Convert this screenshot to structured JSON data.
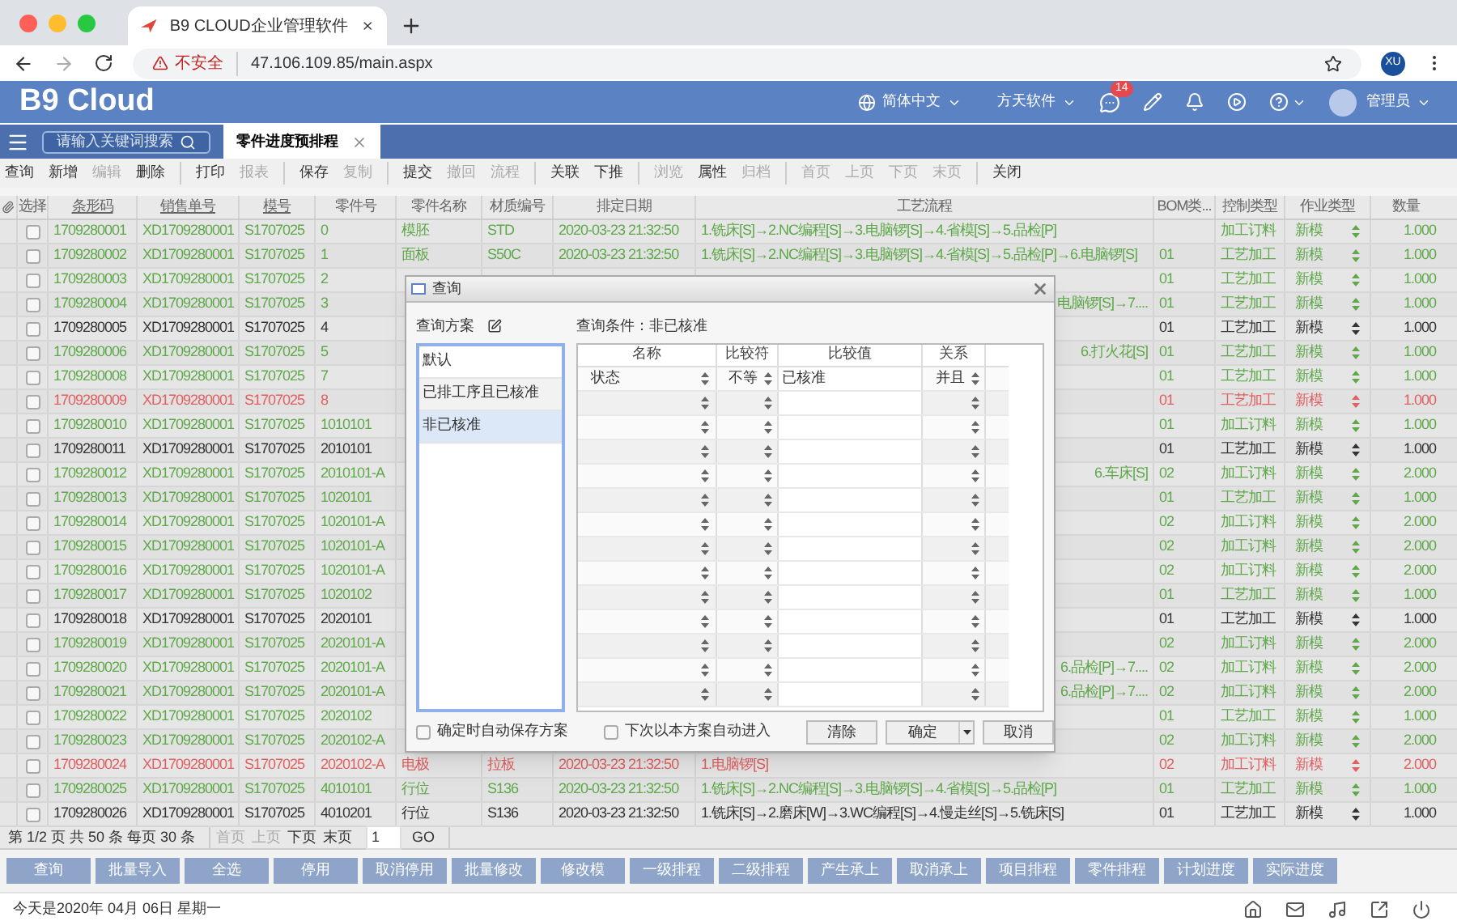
{
  "browser": {
    "tab_title": "B9 CLOUD企业管理软件",
    "url_warning": "不安全",
    "url": "47.106.109.85/main.aspx",
    "profile": "XU"
  },
  "header": {
    "logo": "B9 Cloud",
    "language": "简体中文",
    "company": "方天软件",
    "notification_count": "14",
    "user": "管理员"
  },
  "search": {
    "placeholder": "请输入关键词搜索"
  },
  "tabs": [
    {
      "label": "零件进度预排程",
      "selected": true
    }
  ],
  "toolbar": [
    [
      {
        "label": "查询",
        "disabled": false
      },
      {
        "label": "新增",
        "disabled": false
      },
      {
        "label": "编辑",
        "disabled": true
      },
      {
        "label": "删除",
        "disabled": false
      }
    ],
    [
      {
        "label": "打印",
        "disabled": false
      },
      {
        "label": "报表",
        "disabled": true
      }
    ],
    [
      {
        "label": "保存",
        "disabled": false
      },
      {
        "label": "复制",
        "disabled": true
      }
    ],
    [
      {
        "label": "提交",
        "disabled": false
      },
      {
        "label": "撤回",
        "disabled": true
      },
      {
        "label": "流程",
        "disabled": true
      }
    ],
    [
      {
        "label": "关联",
        "disabled": false
      },
      {
        "label": "下推",
        "disabled": false
      }
    ],
    [
      {
        "label": "浏览",
        "disabled": true
      },
      {
        "label": "属性",
        "disabled": false
      },
      {
        "label": "归档",
        "disabled": true
      }
    ],
    [
      {
        "label": "首页",
        "disabled": true
      },
      {
        "label": "上页",
        "disabled": true
      },
      {
        "label": "下页",
        "disabled": true
      },
      {
        "label": "末页",
        "disabled": true
      }
    ],
    [
      {
        "label": "关闭",
        "disabled": false
      }
    ]
  ],
  "table": {
    "columns": [
      {
        "label": "选择",
        "underlined": false
      },
      {
        "label": "条形码",
        "underlined": true
      },
      {
        "label": "销售单号",
        "underlined": true
      },
      {
        "label": "模号",
        "underlined": true
      },
      {
        "label": "零件号",
        "underlined": false
      },
      {
        "label": "零件名称",
        "underlined": false
      },
      {
        "label": "材质编号",
        "underlined": false
      },
      {
        "label": "排定日期",
        "underlined": false
      },
      {
        "label": "工艺流程",
        "underlined": false
      },
      {
        "label": "BOM类...",
        "underlined": false
      },
      {
        "label": "控制类型",
        "underlined": false
      },
      {
        "label": "作业类型",
        "underlined": false
      },
      {
        "label": "数量",
        "underlined": false
      }
    ],
    "rows": [
      {
        "checked": false,
        "color": "#5fa84a",
        "barcode": "1709280001",
        "order": "XD1709280001",
        "mold": "S1707025",
        "part_no": "0",
        "part_name": "模胚",
        "material": "STD",
        "date": "2020-03-23 21:32:50",
        "process": "1.铣床[S]→2.NC编程[S]→3.电脑锣[S]→4.省模[S]→5.品检[P]",
        "control": "加工订料",
        "job": "新模",
        "qty": "1.000"
      },
      {
        "checked": false,
        "color": "#5fa84a",
        "barcode": "1709280002",
        "order": "XD1709280001",
        "mold": "S1707025",
        "part_no": "1",
        "part_name": "面板",
        "material": "S50C",
        "date": "2020-03-23 21:32:50",
        "process": "1.铣床[S]→2.NC编程[S]→3.电脑锣[S]→4.省模[S]→5.品检[P]→6.电脑锣[S]",
        "bom": "01",
        "control": "工艺加工",
        "job": "新模",
        "qty": "1.000"
      },
      {
        "checked": false,
        "color": "#5fa84a",
        "barcode": "1709280003",
        "order": "XD1709280001",
        "mold": "S1707025",
        "part_no": "2",
        "bom": "01",
        "control": "工艺加工",
        "job": "新模",
        "qty": "1.000"
      },
      {
        "checked": false,
        "color": "#5fa84a",
        "barcode": "1709280004",
        "order": "XD1709280001",
        "mold": "S1707025",
        "part_no": "3",
        "process_tail": "电脑锣[S]→7....",
        "bom": "01",
        "control": "工艺加工",
        "job": "新模",
        "qty": "1.000"
      },
      {
        "checked": false,
        "color": "#333333",
        "barcode": "1709280005",
        "order": "XD1709280001",
        "mold": "S1707025",
        "part_no": "4",
        "bom": "01",
        "control": "工艺加工",
        "job": "新模",
        "qty": "1.000"
      },
      {
        "checked": false,
        "color": "#5fa84a",
        "barcode": "1709280006",
        "order": "XD1709280001",
        "mold": "S1707025",
        "part_no": "5",
        "process_tail": "6.打火花[S]",
        "bom": "01",
        "control": "工艺加工",
        "job": "新模",
        "qty": "1.000"
      },
      {
        "checked": false,
        "color": "#5fa84a",
        "barcode": "1709280008",
        "order": "XD1709280001",
        "mold": "S1707025",
        "part_no": "7",
        "bom": "01",
        "control": "工艺加工",
        "job": "新模",
        "qty": "1.000"
      },
      {
        "checked": false,
        "color": "#e06060",
        "barcode": "1709280009",
        "order": "XD1709280001",
        "mold": "S1707025",
        "part_no": "8",
        "bom": "01",
        "control": "工艺加工",
        "job": "新模",
        "qty": "1.000"
      },
      {
        "checked": false,
        "color": "#5fa84a",
        "barcode": "1709280010",
        "order": "XD1709280001",
        "mold": "S1707025",
        "part_no": "1010101",
        "bom": "01",
        "control": "加工订料",
        "job": "新模",
        "qty": "1.000"
      },
      {
        "checked": false,
        "color": "#333333",
        "barcode": "1709280011",
        "order": "XD1709280001",
        "mold": "S1707025",
        "part_no": "2010101",
        "bom": "01",
        "control": "工艺加工",
        "job": "新模",
        "qty": "1.000"
      },
      {
        "checked": false,
        "color": "#5fa84a",
        "barcode": "1709280012",
        "order": "XD1709280001",
        "mold": "S1707025",
        "part_no": "2010101-A",
        "process_tail": "6.车床[S]",
        "bom": "02",
        "control": "加工订料",
        "job": "新模",
        "qty": "2.000"
      },
      {
        "checked": false,
        "color": "#5fa84a",
        "barcode": "1709280013",
        "order": "XD1709280001",
        "mold": "S1707025",
        "part_no": "1020101",
        "bom": "01",
        "control": "工艺加工",
        "job": "新模",
        "qty": "1.000"
      },
      {
        "checked": false,
        "color": "#5fa84a",
        "barcode": "1709280014",
        "order": "XD1709280001",
        "mold": "S1707025",
        "part_no": "1020101-A",
        "bom": "02",
        "control": "加工订料",
        "job": "新模",
        "qty": "2.000"
      },
      {
        "checked": false,
        "color": "#5fa84a",
        "barcode": "1709280015",
        "order": "XD1709280001",
        "mold": "S1707025",
        "part_no": "1020101-A",
        "bom": "02",
        "control": "加工订料",
        "job": "新模",
        "qty": "2.000"
      },
      {
        "checked": false,
        "color": "#5fa84a",
        "barcode": "1709280016",
        "order": "XD1709280001",
        "mold": "S1707025",
        "part_no": "1020101-A",
        "bom": "02",
        "control": "加工订料",
        "job": "新模",
        "qty": "2.000"
      },
      {
        "checked": false,
        "color": "#5fa84a",
        "barcode": "1709280017",
        "order": "XD1709280001",
        "mold": "S1707025",
        "part_no": "1020102",
        "bom": "01",
        "control": "工艺加工",
        "job": "新模",
        "qty": "1.000"
      },
      {
        "checked": false,
        "color": "#333333",
        "barcode": "1709280018",
        "order": "XD1709280001",
        "mold": "S1707025",
        "part_no": "2020101",
        "bom": "01",
        "control": "工艺加工",
        "job": "新模",
        "qty": "1.000"
      },
      {
        "checked": false,
        "color": "#5fa84a",
        "barcode": "1709280019",
        "order": "XD1709280001",
        "mold": "S1707025",
        "part_no": "2020101-A",
        "bom": "02",
        "control": "加工订料",
        "job": "新模",
        "qty": "2.000"
      },
      {
        "checked": false,
        "color": "#5fa84a",
        "barcode": "1709280020",
        "order": "XD1709280001",
        "mold": "S1707025",
        "part_no": "2020101-A",
        "process_tail": "6.品检[P]→7....",
        "bom": "02",
        "control": "加工订料",
        "job": "新模",
        "qty": "2.000"
      },
      {
        "checked": false,
        "color": "#5fa84a",
        "barcode": "1709280021",
        "order": "XD1709280001",
        "mold": "S1707025",
        "part_no": "2020101-A",
        "process_tail": "6.品检[P]→7....",
        "bom": "02",
        "control": "加工订料",
        "job": "新模",
        "qty": "2.000"
      },
      {
        "checked": false,
        "color": "#5fa84a",
        "barcode": "1709280022",
        "order": "XD1709280001",
        "mold": "S1707025",
        "part_no": "2020102",
        "bom": "01",
        "control": "工艺加工",
        "job": "新模",
        "qty": "1.000"
      },
      {
        "checked": false,
        "color": "#5fa84a",
        "barcode": "1709280023",
        "order": "XD1709280001",
        "mold": "S1707025",
        "part_no": "2020102-A",
        "bom": "02",
        "control": "加工订料",
        "job": "新模",
        "qty": "2.000"
      },
      {
        "checked": false,
        "color": "#e06060",
        "barcode": "1709280024",
        "order": "XD1709280001",
        "mold": "S1707025",
        "part_no": "2020102-A",
        "part_name": "电极",
        "material": "拉板",
        "date": "2020-03-23 21:32:50",
        "process": "1.电脑锣[S]",
        "bom": "02",
        "control": "加工订料",
        "job": "新模",
        "qty": "2.000"
      },
      {
        "checked": false,
        "color": "#5fa84a",
        "barcode": "1709280025",
        "order": "XD1709280001",
        "mold": "S1707025",
        "part_no": "4010101",
        "part_name": "行位",
        "material": "S136",
        "date": "2020-03-23 21:32:50",
        "process": "1.铣床[S]→2.NC编程[S]→3.电脑锣[S]→4.省模[S]→5.品检[P]",
        "bom": "01",
        "control": "工艺加工",
        "job": "新模",
        "qty": "1.000"
      },
      {
        "checked": false,
        "color": "#333333",
        "barcode": "1709280026",
        "order": "XD1709280001",
        "mold": "S1707025",
        "part_no": "4010201",
        "part_name": "行位",
        "material": "S136",
        "date": "2020-03-23 21:32:50",
        "process": "1.铣床[S]→2.磨床[W]→3.WC编程[S]→4.慢走丝[S]→5.铣床[S]",
        "bom": "01",
        "control": "工艺加工",
        "job": "新模",
        "qty": "1.000"
      }
    ]
  },
  "pagination": {
    "summary": "第 1/2 页 共 50 条 每页 30 条",
    "links": [
      {
        "label": "首页",
        "disabled": true
      },
      {
        "label": "上页",
        "disabled": true
      },
      {
        "label": "下页",
        "disabled": false
      },
      {
        "label": "末页",
        "disabled": false
      }
    ],
    "page": "1",
    "go": "GO"
  },
  "actions": [
    "查询",
    "批量导入",
    "全选",
    "停用",
    "取消停用",
    "批量修改",
    "修改模",
    "一级排程",
    "二级排程",
    "产生承上",
    "取消承上",
    "项目排程",
    "零件排程",
    "计划进度",
    "实际进度"
  ],
  "footer": {
    "date": "今天是2020年 04月 06日 星期一"
  },
  "dialog": {
    "title": "查询",
    "scheme_label": "查询方案",
    "schemes": [
      {
        "label": "默认",
        "selected": false
      },
      {
        "label": "已排工序且已核准",
        "selected": false
      },
      {
        "label": "非已核准",
        "selected": true
      }
    ],
    "condition_label": "查询条件：非已核准",
    "columns": [
      "名称",
      "比较符",
      "比较值",
      "关系"
    ],
    "conditions": [
      {
        "kind": "filled",
        "name": "状态",
        "operator": "不等",
        "value": "已核准",
        "relation": "并且"
      },
      {
        "kind": "blank"
      },
      {
        "kind": "blank"
      },
      {
        "kind": "blank"
      },
      {
        "kind": "blank"
      },
      {
        "kind": "blank"
      },
      {
        "kind": "blank"
      },
      {
        "kind": "blank"
      },
      {
        "kind": "blank"
      },
      {
        "kind": "blank"
      },
      {
        "kind": "blank"
      },
      {
        "kind": "blank"
      },
      {
        "kind": "blank"
      },
      {
        "kind": "blank"
      }
    ],
    "options": [
      {
        "label": "确定时自动保存方案",
        "checked": false
      },
      {
        "label": "下次以本方案自动进入",
        "checked": false
      }
    ],
    "buttons": {
      "clear": "清除",
      "confirm": "确定",
      "cancel": "取消"
    }
  }
}
